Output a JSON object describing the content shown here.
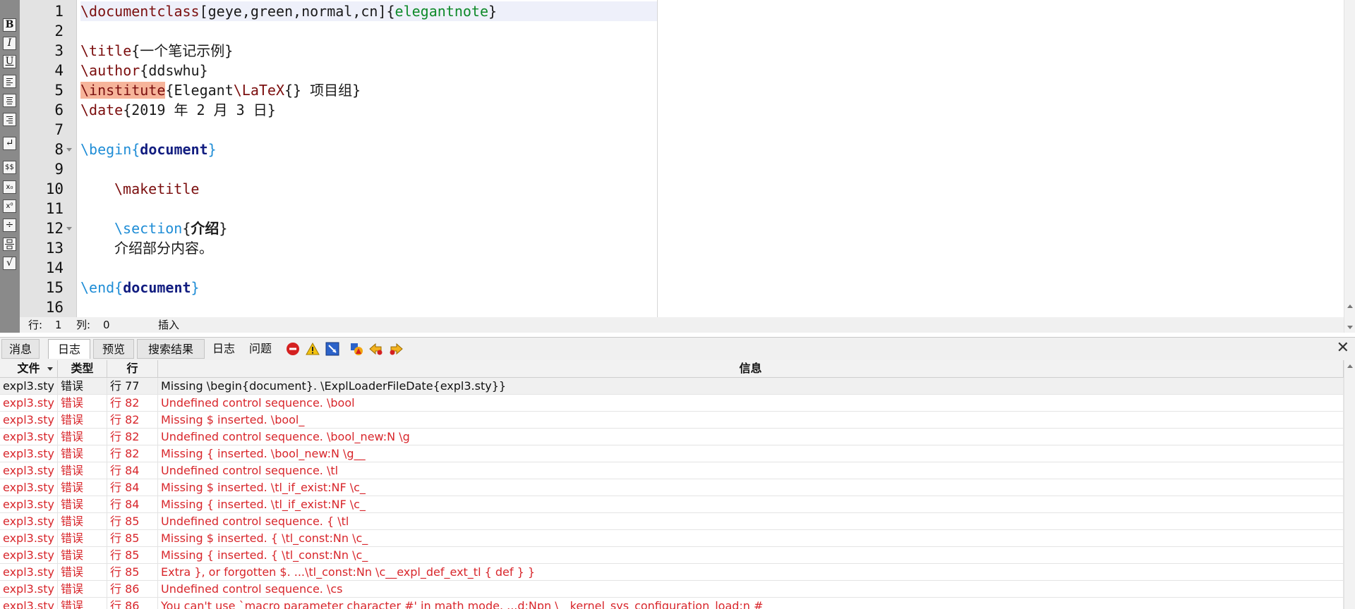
{
  "toolbar": {
    "buttons": [
      {
        "label": "B"
      },
      {
        "label": "I"
      },
      {
        "label": "U"
      },
      {
        "label": "align-left"
      },
      {
        "label": "align-center"
      },
      {
        "label": "align-right"
      },
      {
        "label": "↵"
      },
      {
        "label": "$$"
      },
      {
        "label": "x₀"
      },
      {
        "label": "x⁰"
      },
      {
        "label": "÷"
      },
      {
        "label": "frac"
      },
      {
        "label": "√"
      }
    ]
  },
  "editor": {
    "line_numbers": [
      "1",
      "2",
      "3",
      "4",
      "5",
      "6",
      "7",
      "8",
      "9",
      "10",
      "11",
      "12",
      "13",
      "14",
      "15",
      "16"
    ],
    "lines": {
      "l1": {
        "cmd": "\\documentclass",
        "args": "[geye,green,normal,cn]{",
        "cls": "elegantnote",
        "close": "}"
      },
      "l3": {
        "cmd": "\\title",
        "rest": "{一个笔记示例}"
      },
      "l4": {
        "cmd": "\\author",
        "rest": "{ddswhu}"
      },
      "l5": {
        "cmd": "\\institute",
        "a": "{Elegant",
        "cmd2": "\\LaTeX",
        "b": "{} 项目组}"
      },
      "l6": {
        "cmd": "\\date",
        "rest": "{2019 年 2 月 3 日}"
      },
      "l8": {
        "cmd": "\\begin",
        "open": "{",
        "env": "document",
        "close": "}"
      },
      "l10": {
        "cmd": "\\maketitle"
      },
      "l12": {
        "cmd": "\\section",
        "open": "{",
        "title": "介绍",
        "close": "}"
      },
      "l13": {
        "text": "介绍部分内容。"
      },
      "l15": {
        "cmd": "\\end",
        "open": "{",
        "env": "document",
        "close": "}"
      }
    }
  },
  "statusbar": {
    "row_label": "行:",
    "row_value": "1",
    "col_label": "列:",
    "col_value": "0",
    "mode": "插入"
  },
  "panel": {
    "tabs": [
      "消息",
      "日志",
      "预览",
      "搜索结果",
      "日志",
      "问题"
    ],
    "active_tab": "日志",
    "icons": [
      "stop-error-icon",
      "warning-icon",
      "bad-box-icon",
      "log-filter-icon",
      "prev-error-icon",
      "next-error-icon"
    ]
  },
  "log": {
    "headers": {
      "file": "文件",
      "type": "类型",
      "line": "行",
      "info": "信息"
    },
    "rows": [
      {
        "file": "expl3.sty",
        "type": "错误",
        "line": "行 77",
        "msg": "Missing \\begin{document}. \\ExplLoaderFileDate{expl3.sty}}"
      },
      {
        "file": "expl3.sty",
        "type": "错误",
        "line": "行 82",
        "msg": "Undefined control sequence. \\bool"
      },
      {
        "file": "expl3.sty",
        "type": "错误",
        "line": "行 82",
        "msg": "Missing $ inserted. \\bool_"
      },
      {
        "file": "expl3.sty",
        "type": "错误",
        "line": "行 82",
        "msg": "Undefined control sequence. \\bool_new:N \\g"
      },
      {
        "file": "expl3.sty",
        "type": "错误",
        "line": "行 82",
        "msg": "Missing { inserted. \\bool_new:N \\g__"
      },
      {
        "file": "expl3.sty",
        "type": "错误",
        "line": "行 84",
        "msg": "Undefined control sequence. \\tl"
      },
      {
        "file": "expl3.sty",
        "type": "错误",
        "line": "行 84",
        "msg": "Missing $ inserted. \\tl_if_exist:NF \\c_"
      },
      {
        "file": "expl3.sty",
        "type": "错误",
        "line": "行 84",
        "msg": "Missing { inserted. \\tl_if_exist:NF \\c_"
      },
      {
        "file": "expl3.sty",
        "type": "错误",
        "line": "行 85",
        "msg": "Undefined control sequence. { \\tl"
      },
      {
        "file": "expl3.sty",
        "type": "错误",
        "line": "行 85",
        "msg": "Missing $ inserted. { \\tl_const:Nn \\c_"
      },
      {
        "file": "expl3.sty",
        "type": "错误",
        "line": "行 85",
        "msg": "Missing { inserted. { \\tl_const:Nn \\c_"
      },
      {
        "file": "expl3.sty",
        "type": "错误",
        "line": "行 85",
        "msg": "Extra }, or forgotten $. ...\\tl_const:Nn \\c__expl_def_ext_tl { def } }"
      },
      {
        "file": "expl3.sty",
        "type": "错误",
        "line": "行 86",
        "msg": "Undefined control sequence. \\cs"
      },
      {
        "file": "expl3.sty",
        "type": "错误",
        "line": "行 86",
        "msg": "You can't use `macro parameter character #' in math mode. ...d:Npn \\__kernel_sys_configuration_load:n #"
      }
    ]
  },
  "colors": {
    "error_text": "#d8262b",
    "keyword_blue": "#1f8dd6",
    "command_dark_red": "#7b0e0e",
    "env_navy": "#121d80",
    "class_green": "#0e8a2a",
    "highlight_salmon": "#f6b49a"
  }
}
